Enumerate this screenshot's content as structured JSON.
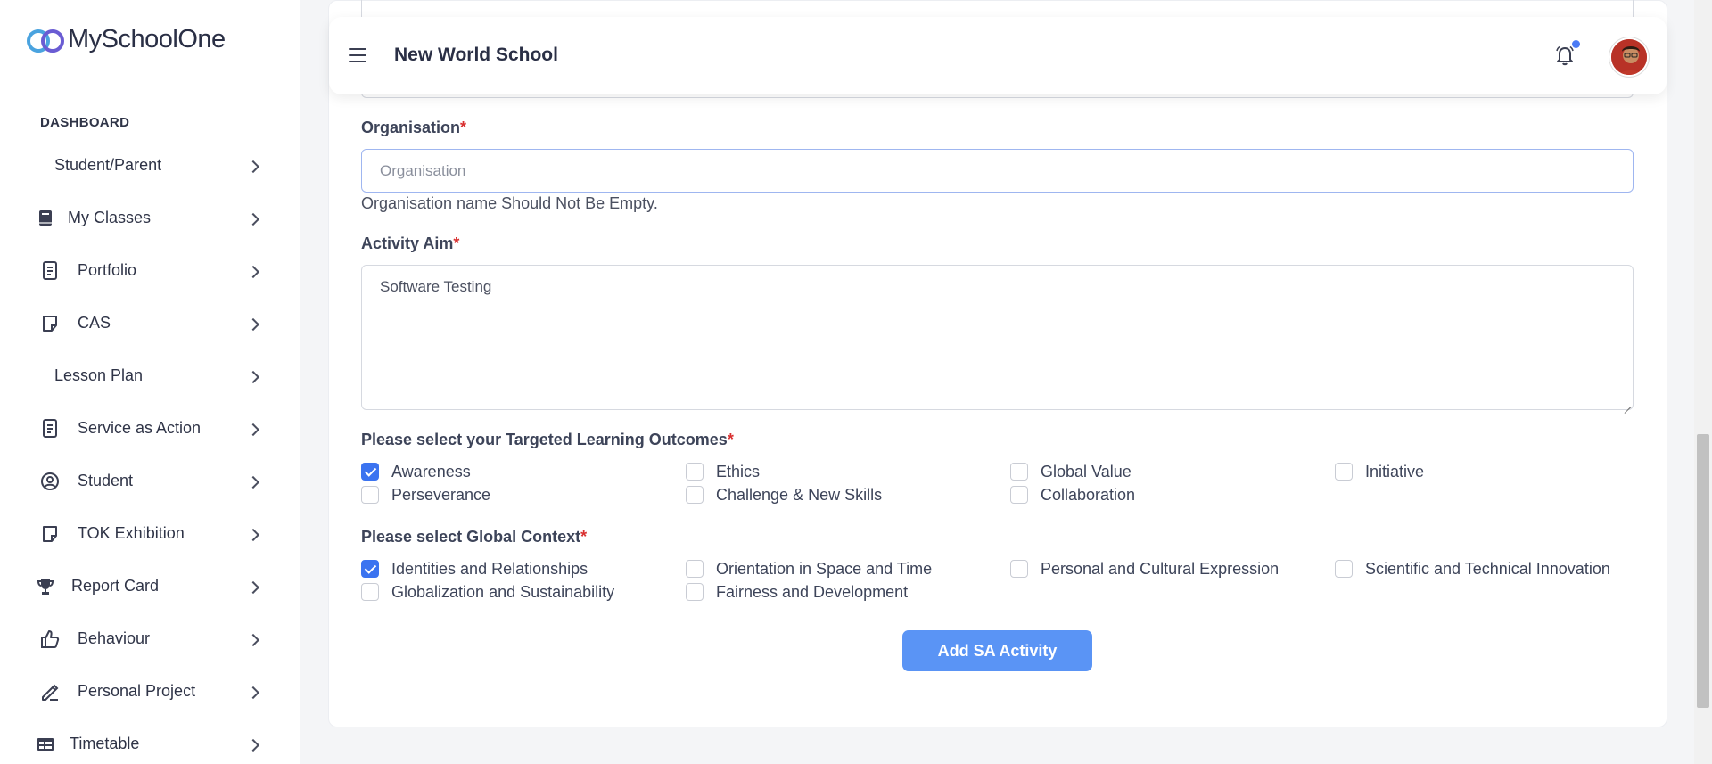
{
  "app": {
    "logo_text": "MySchoolOne"
  },
  "sidebar": {
    "section_label": "DASHBOARD",
    "items": [
      {
        "label": "Student/Parent",
        "icon": "none"
      },
      {
        "label": "My Classes",
        "icon": "book-icon"
      },
      {
        "label": "Portfolio",
        "icon": "document-icon"
      },
      {
        "label": "CAS",
        "icon": "note-icon"
      },
      {
        "label": "Lesson Plan",
        "icon": "none"
      },
      {
        "label": "Service as Action",
        "icon": "document-icon"
      },
      {
        "label": "Student",
        "icon": "user-circle-icon"
      },
      {
        "label": "TOK Exhibition",
        "icon": "note-icon"
      },
      {
        "label": "Report Card",
        "icon": "trophy-icon"
      },
      {
        "label": "Behaviour",
        "icon": "thumbs-up-icon"
      },
      {
        "label": "Personal Project",
        "icon": "pen-icon"
      },
      {
        "label": "Timetable",
        "icon": "table-icon"
      }
    ]
  },
  "header": {
    "school_name": "New World School"
  },
  "form": {
    "organisation": {
      "label": "Organisation",
      "required_mark": "*",
      "placeholder": "Organisation",
      "value": "",
      "error": "Organisation name Should Not Be Empty."
    },
    "activity_aim": {
      "label": "Activity Aim",
      "required_mark": "*",
      "value": "Software Testing"
    },
    "learning_outcomes": {
      "label": "Please select your Targeted Learning Outcomes",
      "required_mark": "*",
      "options": [
        {
          "label": "Awareness",
          "checked": true
        },
        {
          "label": "Ethics",
          "checked": false
        },
        {
          "label": "Global Value",
          "checked": false
        },
        {
          "label": "Initiative",
          "checked": false
        },
        {
          "label": "Perseverance",
          "checked": false
        },
        {
          "label": "Challenge & New Skills",
          "checked": false
        },
        {
          "label": "Collaboration",
          "checked": false
        }
      ]
    },
    "global_context": {
      "label": "Please select Global Context",
      "required_mark": "*",
      "options": [
        {
          "label": "Identities and Relationships",
          "checked": true
        },
        {
          "label": "Orientation in Space and Time",
          "checked": false
        },
        {
          "label": "Personal and Cultural Expression",
          "checked": false
        },
        {
          "label": "Scientific and Technical Innovation",
          "checked": false
        },
        {
          "label": "Globalization and Sustainability",
          "checked": false
        },
        {
          "label": "Fairness and Development",
          "checked": false
        }
      ]
    },
    "submit_label": "Add SA Activity"
  },
  "colors": {
    "accent": "#3b73f0",
    "button": "#5a94f5",
    "required": "#d93030"
  }
}
